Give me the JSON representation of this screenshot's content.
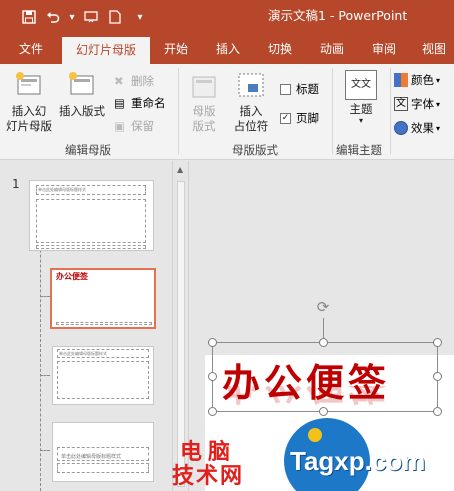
{
  "titlebar": {
    "title": "演示文稿1 - PowerPoint",
    "bg_color": "#b7472a"
  },
  "quick_access": {
    "save_icon": "save-icon",
    "undo_icon": "undo-icon",
    "slideshow_icon": "present-icon",
    "new_icon": "new-file-icon",
    "customize_icon": "chevron-down-icon"
  },
  "tabs": [
    {
      "label": "文件"
    },
    {
      "label": "幻灯片母版"
    },
    {
      "label": "开始"
    },
    {
      "label": "插入"
    },
    {
      "label": "切换"
    },
    {
      "label": "动画"
    },
    {
      "label": "审阅"
    },
    {
      "label": "视图"
    }
  ],
  "ribbon": {
    "insert_slide_master": "插入幻\n灯片母版",
    "insert_layout": "插入版式",
    "delete": "删除",
    "rename": "重命名",
    "preserve": "保留",
    "group_edit_master": "编辑母版",
    "master_layout": "母版\n版式",
    "insert_placeholder": "插入\n占位符",
    "title_chk": "标题",
    "footer_chk": "页脚",
    "group_master_layout": "母版版式",
    "theme": "主题",
    "theme_icon_text": "文文",
    "group_edit_theme": "编辑主题",
    "colors": "颜色",
    "fonts": "字体",
    "effects": "效果",
    "title_checked": "",
    "footer_checked": "✓"
  },
  "thumbnails": {
    "slide_number": "1",
    "master_title": "单击此处编辑母版标题样式",
    "active_title": "办公便签"
  },
  "slide": {
    "title": "办公便签"
  },
  "watermark": {
    "cn_line1": "电脑",
    "cn_line2": "技术网",
    "en": "Tagxp.com"
  }
}
